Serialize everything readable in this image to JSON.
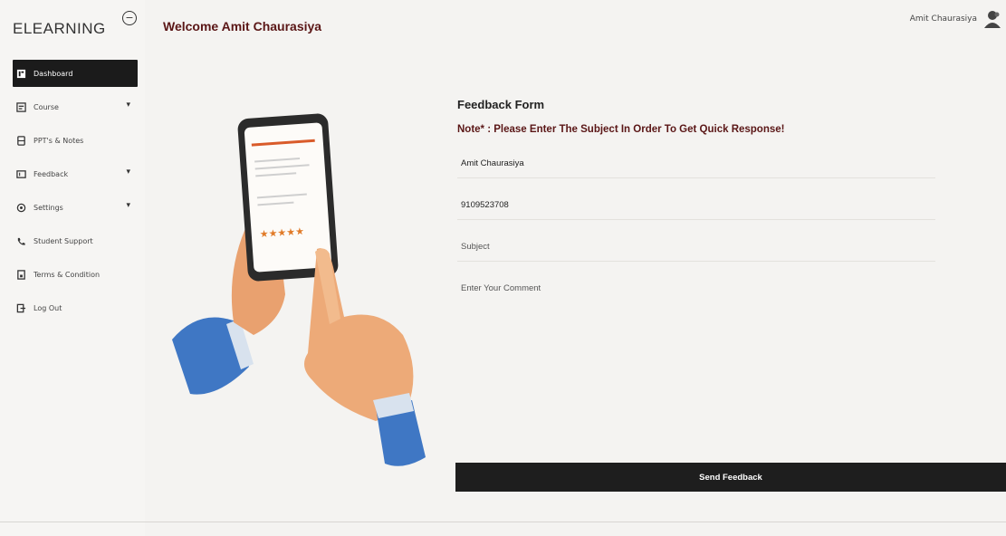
{
  "sidebar": {
    "brand": "ELEARNING",
    "items": [
      {
        "label": "Dashboard",
        "icon": "dashboard-icon"
      },
      {
        "label": "Course",
        "icon": "course-icon",
        "expandable": true
      },
      {
        "label": "PPT's & Notes",
        "icon": "notes-icon"
      },
      {
        "label": "Feedback",
        "icon": "feedback-icon",
        "expandable": true
      },
      {
        "label": "Settings",
        "icon": "settings-icon",
        "expandable": true
      },
      {
        "label": "Student Support",
        "icon": "phone-icon"
      },
      {
        "label": "Terms & Condition",
        "icon": "document-icon"
      },
      {
        "label": "Log Out",
        "icon": "logout-icon"
      }
    ]
  },
  "header": {
    "welcome": "Welcome Amit Chaurasiya",
    "user_name": "Amit Chaurasiya"
  },
  "form": {
    "title": "Feedback Form",
    "note": "Note* : Please Enter The Subject In Order To Get Quick Response!",
    "name_value": "Amit Chaurasiya",
    "phone_value": "9109523708",
    "subject_placeholder": "Subject",
    "comment_placeholder": "Enter Your Comment",
    "submit_label": "Send Feedback"
  },
  "colors": {
    "accent": "#5a1616",
    "nav_active_bg": "#1b1b1b",
    "button_bg": "#1e1e1e",
    "page_bg": "#f4f3f1"
  }
}
